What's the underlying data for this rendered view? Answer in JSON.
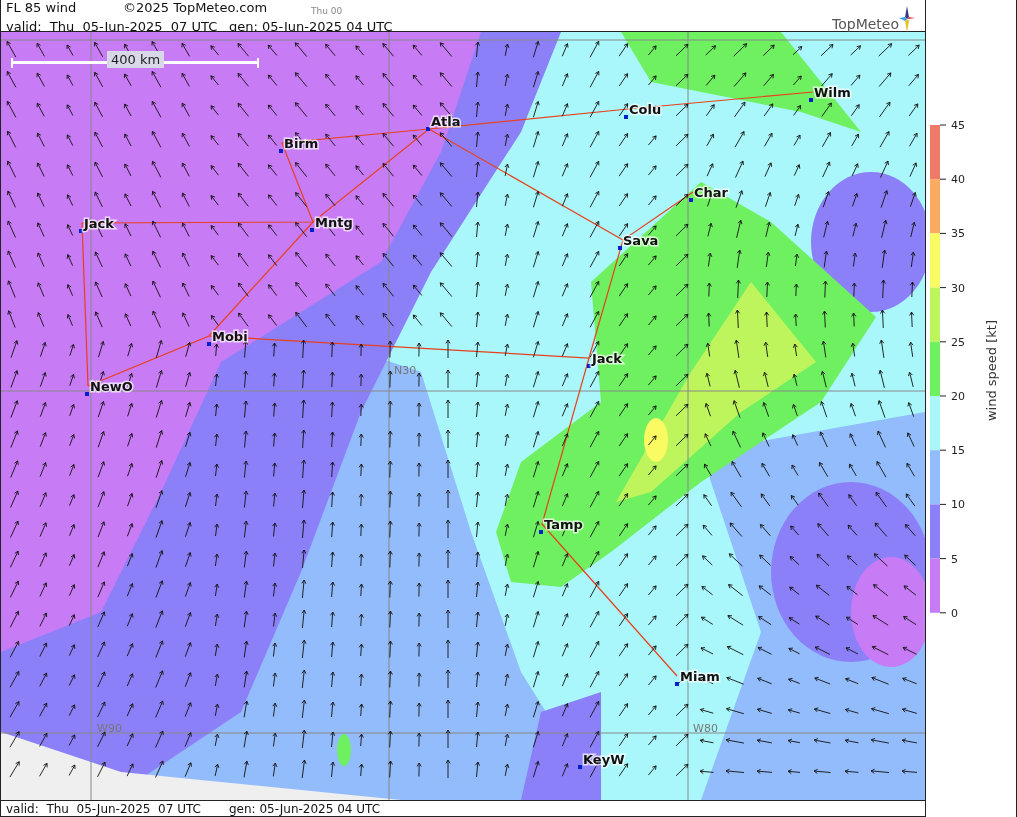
{
  "header": {
    "title": "FL 85 wind",
    "copyright": "©2025 TopMeteo.com",
    "step": "Thu 00",
    "valid": "valid:  Thu  05-Jun-2025  07 UTC",
    "generated": "gen: 05-Jun-2025 04 UTC",
    "logo": "TopMeteo"
  },
  "map": {
    "scale": "400 km",
    "grid_labels": [
      "N30",
      "W90",
      "W80"
    ],
    "cities": [
      "Wilm",
      "Colu",
      "Atla",
      "Birm",
      "Char",
      "Jack",
      "Mntg",
      "Sava",
      "Mobi",
      "Jack",
      "NewO",
      "Tamp",
      "Miam",
      "KeyW"
    ]
  },
  "legend": {
    "title": "wind speed [kt]",
    "ticks": [
      "45",
      "40",
      "35",
      "30",
      "25",
      "20",
      "15",
      "10",
      "5",
      "0"
    ],
    "bins": [
      {
        "color": "#f07a68"
      },
      {
        "color": "#f9ac60"
      },
      {
        "color": "#fafa63"
      },
      {
        "color": "#bff55c"
      },
      {
        "color": "#6ff060"
      },
      {
        "color": "#a9f7fb"
      },
      {
        "color": "#92bcfb"
      },
      {
        "color": "#8c80f9"
      },
      {
        "color": "#c77bf5"
      }
    ]
  },
  "footer": {
    "valid": "valid:  Thu  05-Jun-2025  07 UTC",
    "generated": "gen: 05-Jun-2025 04 UTC"
  }
}
